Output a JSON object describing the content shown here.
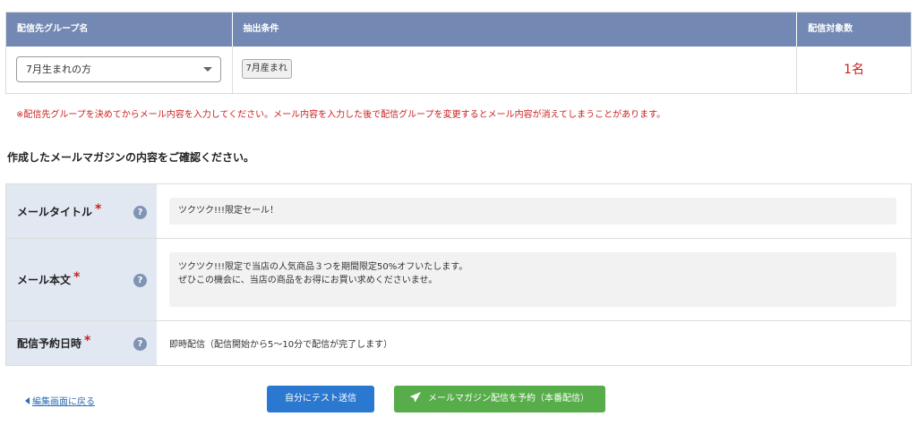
{
  "group_table": {
    "headers": [
      "配信先グループ名",
      "抽出条件",
      "配信対象数"
    ],
    "selected_group": "7月生まれの方",
    "condition_tag": "7月産まれ",
    "target_count": "1名"
  },
  "warning": "※配信先グループを決めてからメール内容を入力してください。メール内容を入力した後で配信グループを変更するとメール内容が消えてしまうことがあります。",
  "section_title": "作成したメールマガジンの内容をご確認ください。",
  "confirm": {
    "title_label": "メールタイトル",
    "title_value": "ツクツク!!!限定セール！",
    "body_label": "メール本文",
    "body_line1": "ツクツク!!!限定で当店の人気商品３つを期間限定50%オフいたします。",
    "body_line2": "ぜひこの機会に、当店の商品をお得にお買い求めくださいませ。",
    "schedule_label": "配信予約日時",
    "schedule_value": "即時配信（配信開始から5〜10分で配信が完了します）",
    "required_mark": "*",
    "help_mark": "?"
  },
  "actions": {
    "back_label": "編集画面に戻る",
    "test_label": "自分にテスト送信",
    "send_label": "メールマガジン配信を予約（本番配信）"
  },
  "colors": {
    "header_bg": "#7389b4",
    "label_bg": "#e1e8f2",
    "alert_red": "#cc1f1f",
    "primary_blue": "#2a78cf",
    "send_green": "#57ad4a",
    "link_blue": "#2d6db5"
  },
  "icons": {
    "select_arrow": "chevron-down-icon",
    "help": "question-circle-icon",
    "back": "caret-left-icon",
    "send": "paper-plane-icon"
  }
}
